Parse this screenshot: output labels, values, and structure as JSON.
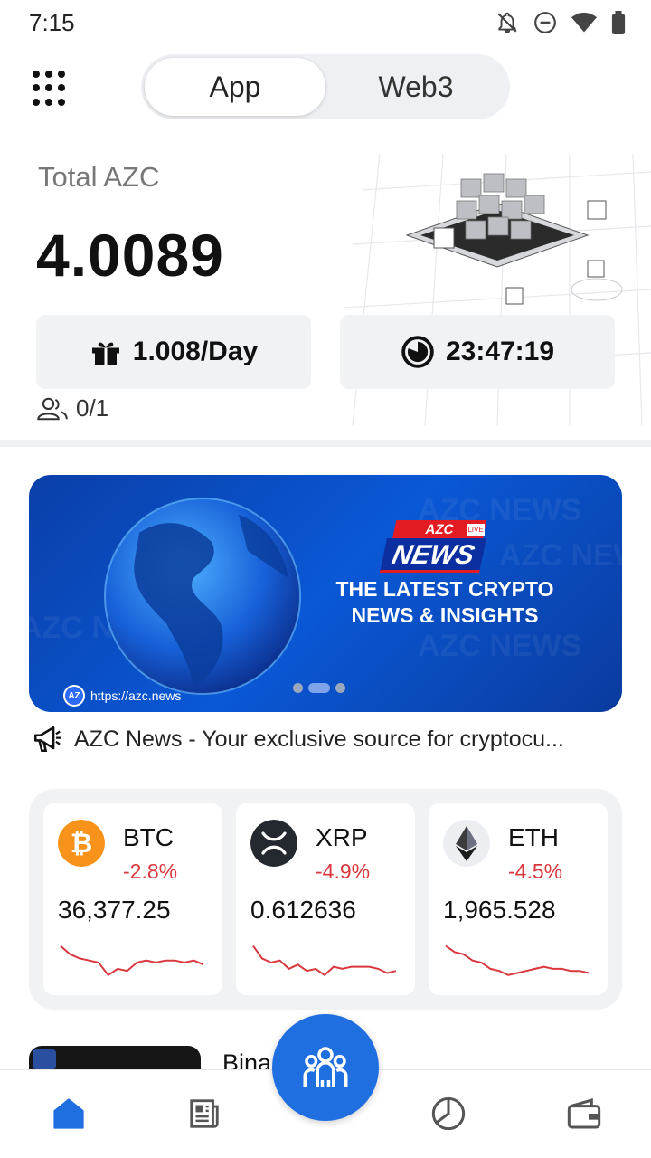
{
  "status_bar": {
    "time": "7:15"
  },
  "top_tabs": [
    {
      "label": "App",
      "active": true
    },
    {
      "label": "Web3",
      "active": false
    }
  ],
  "balance": {
    "label": "Total AZC",
    "value": "4.0089",
    "rate": "1.008/Day",
    "timer": "23:47:19",
    "invites": "0/1"
  },
  "banner": {
    "badge_top": "AZC",
    "badge_live": "LIVE",
    "badge_main": "NEWS",
    "headline_line1": "THE LATEST CRYPTO",
    "headline_line2": "NEWS & INSIGHTS",
    "url": "https://azc.news",
    "url_logo": "AZ",
    "bg_text": "AZC NEWS"
  },
  "ticker": {
    "text": "AZC News - Your exclusive source for cryptocu..."
  },
  "coins": [
    {
      "symbol": "BTC",
      "change": "-2.8%",
      "price": "36,377.25",
      "spark": [
        0.9,
        0.7,
        0.6,
        0.55,
        0.5,
        0.2,
        0.35,
        0.3,
        0.5,
        0.55,
        0.5,
        0.55,
        0.55,
        0.5,
        0.55,
        0.45
      ]
    },
    {
      "symbol": "XRP",
      "change": "-4.9%",
      "price": "0.612636",
      "spark": [
        0.9,
        0.6,
        0.5,
        0.55,
        0.35,
        0.45,
        0.3,
        0.35,
        0.2,
        0.4,
        0.35,
        0.4,
        0.4,
        0.4,
        0.35,
        0.25,
        0.3
      ]
    },
    {
      "symbol": "ETH",
      "change": "-4.5%",
      "price": "1,965.528",
      "spark": [
        0.9,
        0.75,
        0.7,
        0.55,
        0.5,
        0.35,
        0.3,
        0.2,
        0.25,
        0.3,
        0.35,
        0.4,
        0.35,
        0.35,
        0.3,
        0.3,
        0.25
      ]
    }
  ],
  "peek": {
    "title": "Bina          s Boosts"
  },
  "colors": {
    "accent": "#1f6fe0",
    "negative": "#d9383f",
    "btc": "#f7931a",
    "xrp": "#23292f"
  },
  "nav": {
    "items": [
      "home-icon",
      "news-icon",
      "community-icon",
      "portfolio-icon",
      "wallet-icon"
    ]
  }
}
